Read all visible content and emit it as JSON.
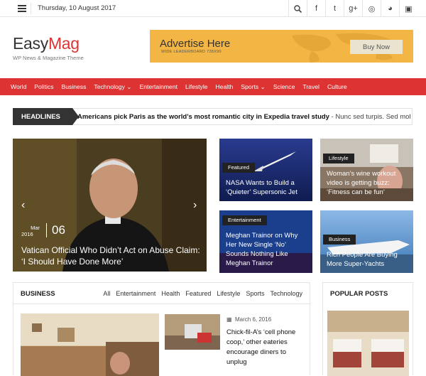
{
  "topbar": {
    "date": "Thursday, 10 August 2017",
    "icons": [
      "search-icon",
      "facebook-icon",
      "twitter-icon",
      "google-plus-icon",
      "instagram-icon",
      "github-icon",
      "flickr-icon"
    ],
    "icon_glyphs": [
      "⌕",
      "f",
      "t",
      "g+",
      "◎",
      "◕",
      "▣"
    ]
  },
  "logo": {
    "name_part1": "Easy",
    "name_part2": "Mag",
    "tagline": "WP News & Magazine Theme"
  },
  "ad": {
    "headline": "Advertise Here",
    "subline": "WIDE LEADERBOARD 728X90",
    "button": "Buy Now"
  },
  "nav": {
    "items": [
      "World",
      "Politics",
      "Business",
      "Technology",
      "Entertainment",
      "Lifestyle",
      "Health",
      "Sports",
      "Science",
      "Travel",
      "Culture"
    ],
    "dropdown_marker": "⌄"
  },
  "headlines": {
    "label": "HEADLINES",
    "title": "Americans pick Paris as the world’s most romantic city in Expedia travel study",
    "excerpt": " - Nunc sed turpis. Sed mollis,"
  },
  "slider": {
    "month": "Mar",
    "year": "2016",
    "day": "06",
    "title": "Vatican Official Who Didn’t Act on Abuse Claim: ‘I Should Have Done More’",
    "prev": "‹",
    "next": "›"
  },
  "cards": [
    {
      "badge": "Featured",
      "title": "NASA Wants to Build a ‘Quieter’ Supersonic Jet"
    },
    {
      "badge": "Lifestyle",
      "title": "Woman’s wine workout video is getting buzz: ‘Fitness can be fun’"
    },
    {
      "badge": "Entertainment",
      "title": "Meghan Trainor on Why Her New Single ‘No’ Sounds Nothing Like Meghan Trainor"
    },
    {
      "badge": "Business",
      "title": "Rich People Are Buying More Super-Yachts"
    }
  ],
  "business": {
    "title": "BUSINESS",
    "tabs": [
      "All",
      "Entertainment",
      "Health",
      "Featured",
      "Lifestyle",
      "Sports",
      "Technology"
    ],
    "post_date": "March 6, 2016",
    "post_title": "Chick-fil-A’s ‘cell phone coop,’ other eateries encourage diners to unplug"
  },
  "popular": {
    "title": "POPULAR POSTS"
  },
  "colors": {
    "accent": "#dd3333",
    "ad": "#f3b645",
    "dark": "#333333"
  }
}
